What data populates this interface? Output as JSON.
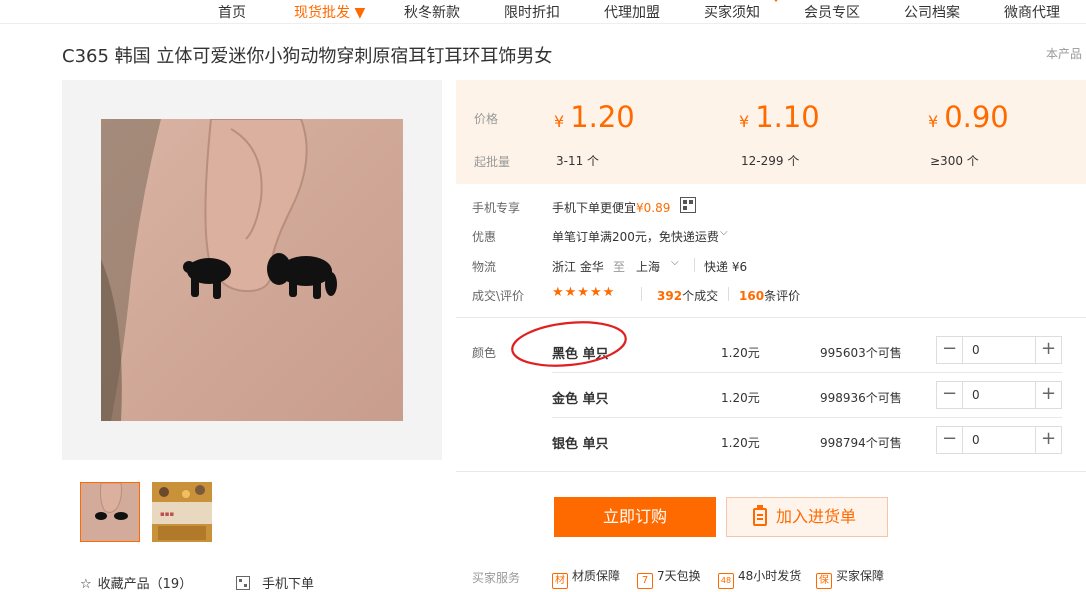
{
  "nav": {
    "items": [
      {
        "label": "首页",
        "active": false
      },
      {
        "label": "现货批发 ▼",
        "active": true
      },
      {
        "label": "秋冬新款",
        "active": false
      },
      {
        "label": "限时折扣",
        "active": false
      },
      {
        "label": "代理加盟",
        "active": false
      },
      {
        "label": "买家须知",
        "active": false
      },
      {
        "label": "会员专区",
        "active": false
      },
      {
        "label": "公司档案",
        "active": false
      },
      {
        "label": "微商代理",
        "active": false
      }
    ],
    "accent": "#ff6a00"
  },
  "product": {
    "title": "C365 韩国 立体可爱迷你小狗动物穿刺原宿耳钉耳环耳饰男女",
    "right_note": "本产品"
  },
  "gallery": {
    "selected_thumb": 0,
    "favorite_label": "收藏产品（19）",
    "mobile_order_label": "手机下单"
  },
  "pricing": {
    "price_label": "价格",
    "moq_label": "起批量",
    "currency": "¥",
    "tiers": [
      {
        "price": "1.20",
        "range": "3-11 个"
      },
      {
        "price": "1.10",
        "range": "12-299 个"
      },
      {
        "price": "0.90",
        "range": "≥300 个"
      }
    ]
  },
  "info": {
    "mobile": {
      "label": "手机专享",
      "text": "手机下单更便宜",
      "price": "¥0.89"
    },
    "promo": {
      "label": "优惠",
      "text": "单笔订单满200元，免快递运费"
    },
    "logistics": {
      "label": "物流",
      "from": "浙江 金华",
      "to_word": "至",
      "to": "上海",
      "express": "快递 ¥6"
    },
    "trade": {
      "label": "成交\\评价",
      "stars": "★★★★★",
      "deals_count": "392",
      "deals_text": "个成交",
      "reviews_count": "160",
      "reviews_text": "条评价"
    }
  },
  "sku": {
    "label": "颜色",
    "rows": [
      {
        "name": "黑色 单只",
        "price": "1.20元",
        "stock": "995603个可售",
        "qty": "0"
      },
      {
        "name": "金色 单只",
        "price": "1.20元",
        "stock": "998936个可售",
        "qty": "0"
      },
      {
        "name": "银色 单只",
        "price": "1.20元",
        "stock": "998794个可售",
        "qty": "0"
      }
    ],
    "annotation_color": "#e02020"
  },
  "actions": {
    "order_label": "立即订购",
    "cart_label": "加入进货单"
  },
  "services": {
    "label": "买家服务",
    "items": [
      {
        "icon": "材",
        "text": "材质保障"
      },
      {
        "icon": "7",
        "text": "7天包换"
      },
      {
        "icon": "48",
        "text": "48小时发货"
      },
      {
        "icon": "保",
        "text": "买家保障"
      }
    ]
  }
}
